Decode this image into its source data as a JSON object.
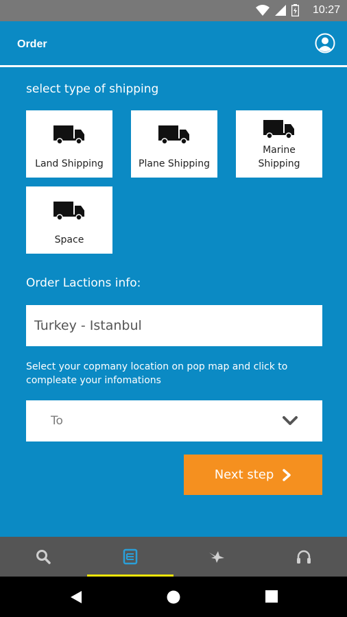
{
  "status_bar": {
    "time": "10:27"
  },
  "app_bar": {
    "title": "Order"
  },
  "shipping": {
    "label": "select type of shipping",
    "options": [
      {
        "label": "Land Shipping"
      },
      {
        "label": "Plane Shipping"
      },
      {
        "label": "Marine Shipping"
      },
      {
        "label": "Space"
      }
    ]
  },
  "locations": {
    "label": "Order Lactions info:",
    "from_value": "Turkey - Istanbul",
    "helper": "Select your copmany location on pop map and click to compleate your infomations",
    "to_placeholder": "To"
  },
  "actions": {
    "next_label": "Next step"
  },
  "bottom_nav": {
    "items": [
      "search-icon",
      "list-icon",
      "bird-icon",
      "headphones-icon"
    ],
    "active_index": 1,
    "indicator_color": "#f2e60a"
  },
  "colors": {
    "primary": "#0b8ac4",
    "accent": "#f5901f",
    "nav_bg": "#555555"
  }
}
